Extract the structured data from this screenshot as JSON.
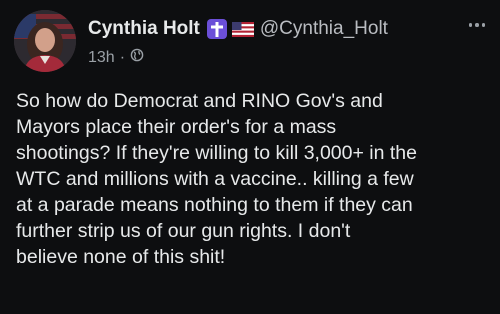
{
  "post": {
    "author": {
      "display_name": "Cynthia Holt",
      "handle": "@Cynthia_Holt",
      "badge_icon": "cross-icon",
      "flag_icon": "us-flag-icon",
      "avatar_icon": "avatar-photo"
    },
    "meta": {
      "time": "13h",
      "separator": "·",
      "audience_icon": "globe-icon"
    },
    "more_icon": "more-options-icon",
    "text": "So how do Democrat and RINO Gov's and\nMayors place their order's for a mass\nshootings? If they're willing to kill 3,000+ in the\nWTC and millions with a vaccine.. killing a few\nat a parade means nothing to them if they can\nfurther strip us of our gun rights. I don't\nbelieve none of this shit!"
  },
  "colors": {
    "background": "#0d0e10",
    "text_primary": "#e7e9ea",
    "text_secondary": "#9aa0a6",
    "badge": "#6b4fd8"
  }
}
